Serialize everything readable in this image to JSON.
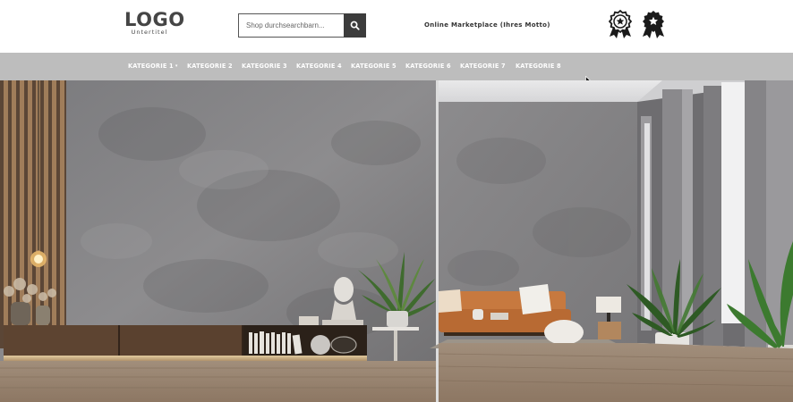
{
  "header": {
    "logo": {
      "title": "LOGO",
      "subtitle": "Untertitel"
    },
    "search": {
      "placeholder": "Shop durchsearchbarn...",
      "icon": "search-icon"
    },
    "motto": "Online Marketplace (Ihres Motto)",
    "badges": [
      {
        "icon": "award-rosette-outline-icon"
      },
      {
        "icon": "award-rosette-filled-icon"
      }
    ]
  },
  "nav": {
    "items": [
      {
        "label": "KATEGORIE 1",
        "dropdown": true
      },
      {
        "label": "KATEGORIE 2"
      },
      {
        "label": "KATEGORIE 3"
      },
      {
        "label": "KATEGORIE 4"
      },
      {
        "label": "KATEGORIE 5"
      },
      {
        "label": "KATEGORIE 6"
      },
      {
        "label": "KATEGORIE 7"
      },
      {
        "label": "KATEGORIE 8"
      }
    ],
    "caret": "▾"
  },
  "hero": {
    "content": "interior-photo"
  },
  "colors": {
    "nav_bg": "#bdbdbd",
    "search_button": "#3c3c3c",
    "text_dark": "#333333",
    "logo": "#454545"
  }
}
